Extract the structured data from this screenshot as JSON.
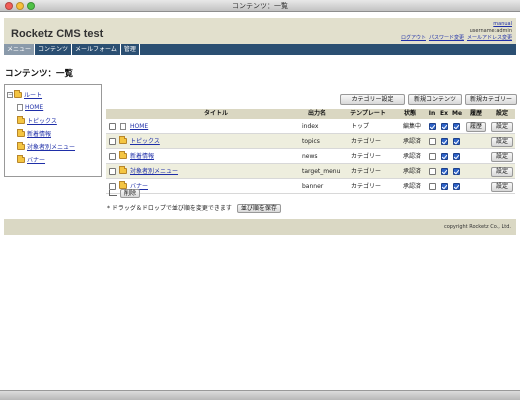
{
  "window": {
    "title": "コンテンツ：一覧"
  },
  "header": {
    "site_title": "Rocketz CMS test",
    "manual": "manual",
    "username": "username:admin",
    "logout": "ログアウト",
    "change_password": "パスワード変更",
    "change_email": "メールアドレス変更"
  },
  "nav": {
    "items": [
      {
        "label": "メニュー",
        "active": true
      },
      {
        "label": "コンテンツ",
        "active": false
      },
      {
        "label": "メールフォーム",
        "active": false
      },
      {
        "label": "管理",
        "active": false
      }
    ]
  },
  "page_title": "コンテンツ：一覧",
  "tree": {
    "root_label": "ルート",
    "toggle": "－",
    "items": [
      "HOME",
      "トピックス",
      "新着情報",
      "対象者別メニュー",
      "バナー"
    ]
  },
  "toolbar": {
    "category_settings": "カテゴリー設定",
    "new_content": "新規コンテンツ",
    "new_category": "新規カテゴリー"
  },
  "table": {
    "headers": {
      "title": "タイトル",
      "output_name": "出力名",
      "template": "テンプレート",
      "status": "状態",
      "in": "In",
      "ex": "Ex",
      "me": "Me",
      "history": "履歴",
      "settings": "設定"
    },
    "rows": [
      {
        "title": "HOME",
        "output": "index",
        "template": "トップ",
        "status": "編集中",
        "in": true,
        "ex": true,
        "me": true,
        "history": "履歴",
        "settings": "設定",
        "is_folder": false
      },
      {
        "title": "トピックス",
        "output": "topics",
        "template": "カテゴリー",
        "status": "承認済",
        "in": false,
        "ex": true,
        "me": true,
        "history": "",
        "settings": "設定",
        "is_folder": true
      },
      {
        "title": "新着情報",
        "output": "news",
        "template": "カテゴリー",
        "status": "承認済",
        "in": false,
        "ex": true,
        "me": true,
        "history": "",
        "settings": "設定",
        "is_folder": true
      },
      {
        "title": "対象者別メニュー",
        "output": "target_menu",
        "template": "カテゴリー",
        "status": "承認済",
        "in": false,
        "ex": true,
        "me": true,
        "history": "",
        "settings": "設定",
        "is_folder": true
      },
      {
        "title": "バナー",
        "output": "banner",
        "template": "カテゴリー",
        "status": "承認済",
        "in": false,
        "ex": true,
        "me": true,
        "history": "",
        "settings": "設定",
        "is_folder": true
      }
    ]
  },
  "bulk_delete": "削除",
  "note": "* ドラッグ＆ドロップで並び順を変更できます",
  "save_order": "並び順を保存",
  "footer": {
    "copyright": "copyright Rocketz Co., Ltd."
  },
  "colors": {
    "nav_bg": "#2b4f72",
    "header_bg": "#e2e0cd",
    "link": "#1f2fa8",
    "checkbox_on": "#2e63c8"
  }
}
